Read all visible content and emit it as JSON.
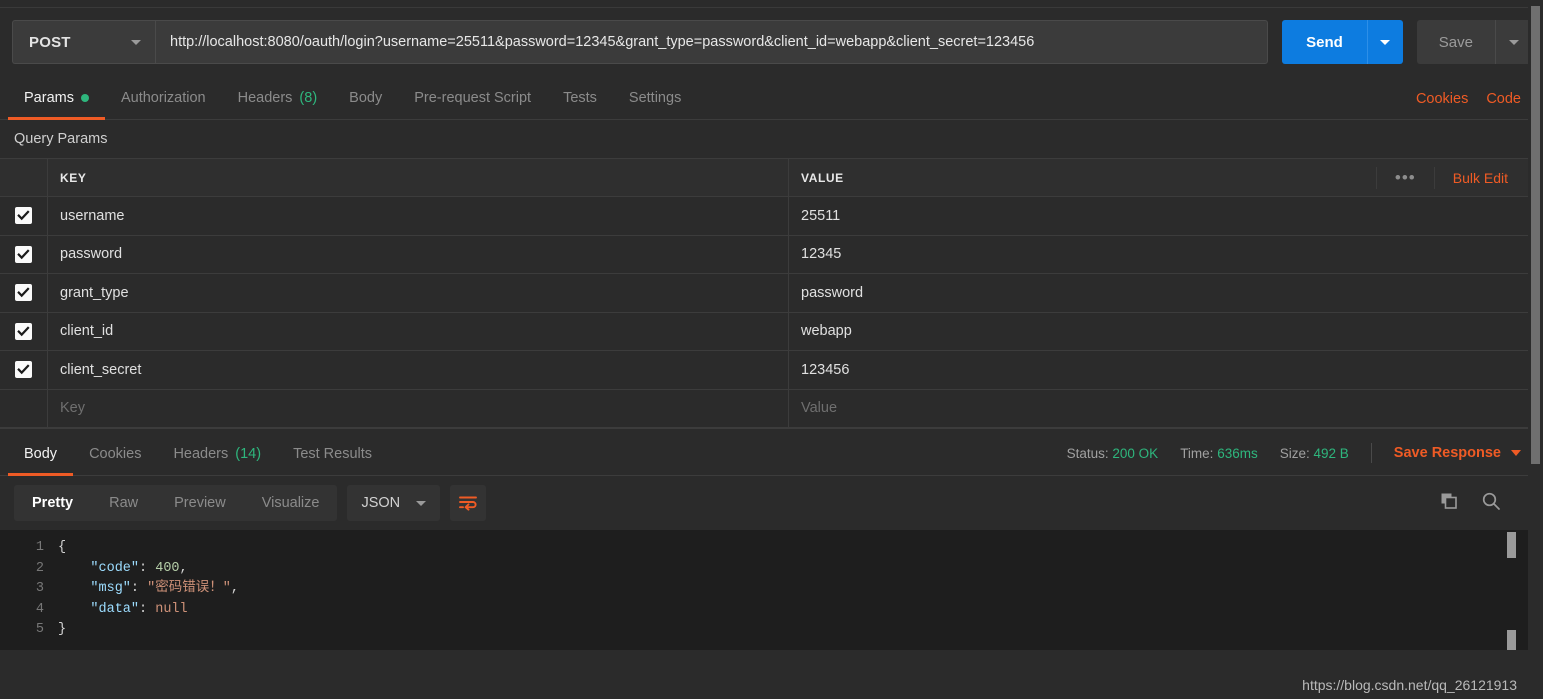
{
  "request": {
    "method": "POST",
    "method_caret_icon": "chevron-down-icon",
    "url": "http://localhost:8080/oauth/login?username=25511&password=12345&grant_type=password&client_id=webapp&client_secret=123456",
    "send_label": "Send",
    "send_caret_icon": "chevron-down-icon",
    "save_label": "Save",
    "save_caret_icon": "chevron-down-icon",
    "accent_blue": "#0d7ce0",
    "accent_orange": "#ef5b25"
  },
  "request_tabs": {
    "items": [
      {
        "label": "Params",
        "badge": "",
        "has_dot": true,
        "active": true
      },
      {
        "label": "Authorization",
        "badge": "",
        "has_dot": false,
        "active": false
      },
      {
        "label": "Headers",
        "badge": "(8)",
        "has_dot": false,
        "active": false
      },
      {
        "label": "Body",
        "badge": "",
        "has_dot": false,
        "active": false
      },
      {
        "label": "Pre-request Script",
        "badge": "",
        "has_dot": false,
        "active": false
      },
      {
        "label": "Tests",
        "badge": "",
        "has_dot": false,
        "active": false
      },
      {
        "label": "Settings",
        "badge": "",
        "has_dot": false,
        "active": false
      }
    ],
    "cookies_label": "Cookies",
    "code_label": "Code"
  },
  "query_params": {
    "section_title": "Query Params",
    "headers": {
      "key": "KEY",
      "value": "VALUE"
    },
    "more_icon": "ellipsis-icon",
    "bulk_edit_label": "Bulk Edit",
    "rows": [
      {
        "checked": true,
        "key": "username",
        "value": "25511"
      },
      {
        "checked": true,
        "key": "password",
        "value": "12345"
      },
      {
        "checked": true,
        "key": "grant_type",
        "value": "password"
      },
      {
        "checked": true,
        "key": "client_id",
        "value": "webapp"
      },
      {
        "checked": true,
        "key": "client_secret",
        "value": "123456"
      }
    ],
    "empty_row": {
      "key_placeholder": "Key",
      "value_placeholder": "Value"
    }
  },
  "response_tabs": {
    "items": [
      {
        "label": "Body",
        "badge": "",
        "active": true
      },
      {
        "label": "Cookies",
        "badge": "",
        "active": false
      },
      {
        "label": "Headers",
        "badge": "(14)",
        "active": false
      },
      {
        "label": "Test Results",
        "badge": "",
        "active": false
      }
    ],
    "status_label": "Status:",
    "status_value": "200 OK",
    "time_label": "Time:",
    "time_value": "636ms",
    "size_label": "Size:",
    "size_value": "492 B",
    "save_response_label": "Save Response",
    "save_response_caret_icon": "chevron-down-icon",
    "status_color": "#2eb67d"
  },
  "body_toolbar": {
    "view_modes": [
      {
        "label": "Pretty",
        "active": true
      },
      {
        "label": "Raw",
        "active": false
      },
      {
        "label": "Preview",
        "active": false
      },
      {
        "label": "Visualize",
        "active": false
      }
    ],
    "format": "JSON",
    "format_caret_icon": "chevron-down-icon",
    "wrap_icon": "word-wrap-icon",
    "copy_icon": "copy-icon",
    "search_icon": "search-icon"
  },
  "response_body": {
    "line_numbers": [
      "1",
      "2",
      "3",
      "4",
      "5"
    ],
    "lines": [
      [
        {
          "t": "{",
          "c": "brace"
        }
      ],
      [
        {
          "t": "    ",
          "c": "punc"
        },
        {
          "t": "\"code\"",
          "c": "key"
        },
        {
          "t": ": ",
          "c": "punc"
        },
        {
          "t": "400",
          "c": "num"
        },
        {
          "t": ",",
          "c": "punc"
        }
      ],
      [
        {
          "t": "    ",
          "c": "punc"
        },
        {
          "t": "\"msg\"",
          "c": "key"
        },
        {
          "t": ": ",
          "c": "punc"
        },
        {
          "t": "\"密码错误！\"",
          "c": "str"
        },
        {
          "t": ",",
          "c": "punc"
        }
      ],
      [
        {
          "t": "    ",
          "c": "punc"
        },
        {
          "t": "\"data\"",
          "c": "key"
        },
        {
          "t": ": ",
          "c": "punc"
        },
        {
          "t": "null",
          "c": "null"
        }
      ],
      [
        {
          "t": "}",
          "c": "brace"
        }
      ]
    ],
    "raw_text": "{\n    \"code\": 400,\n    \"msg\": \"密码错误！\",\n    \"data\": null\n}"
  },
  "watermark": {
    "text": "https://blog.csdn.net/qq_26121913"
  }
}
